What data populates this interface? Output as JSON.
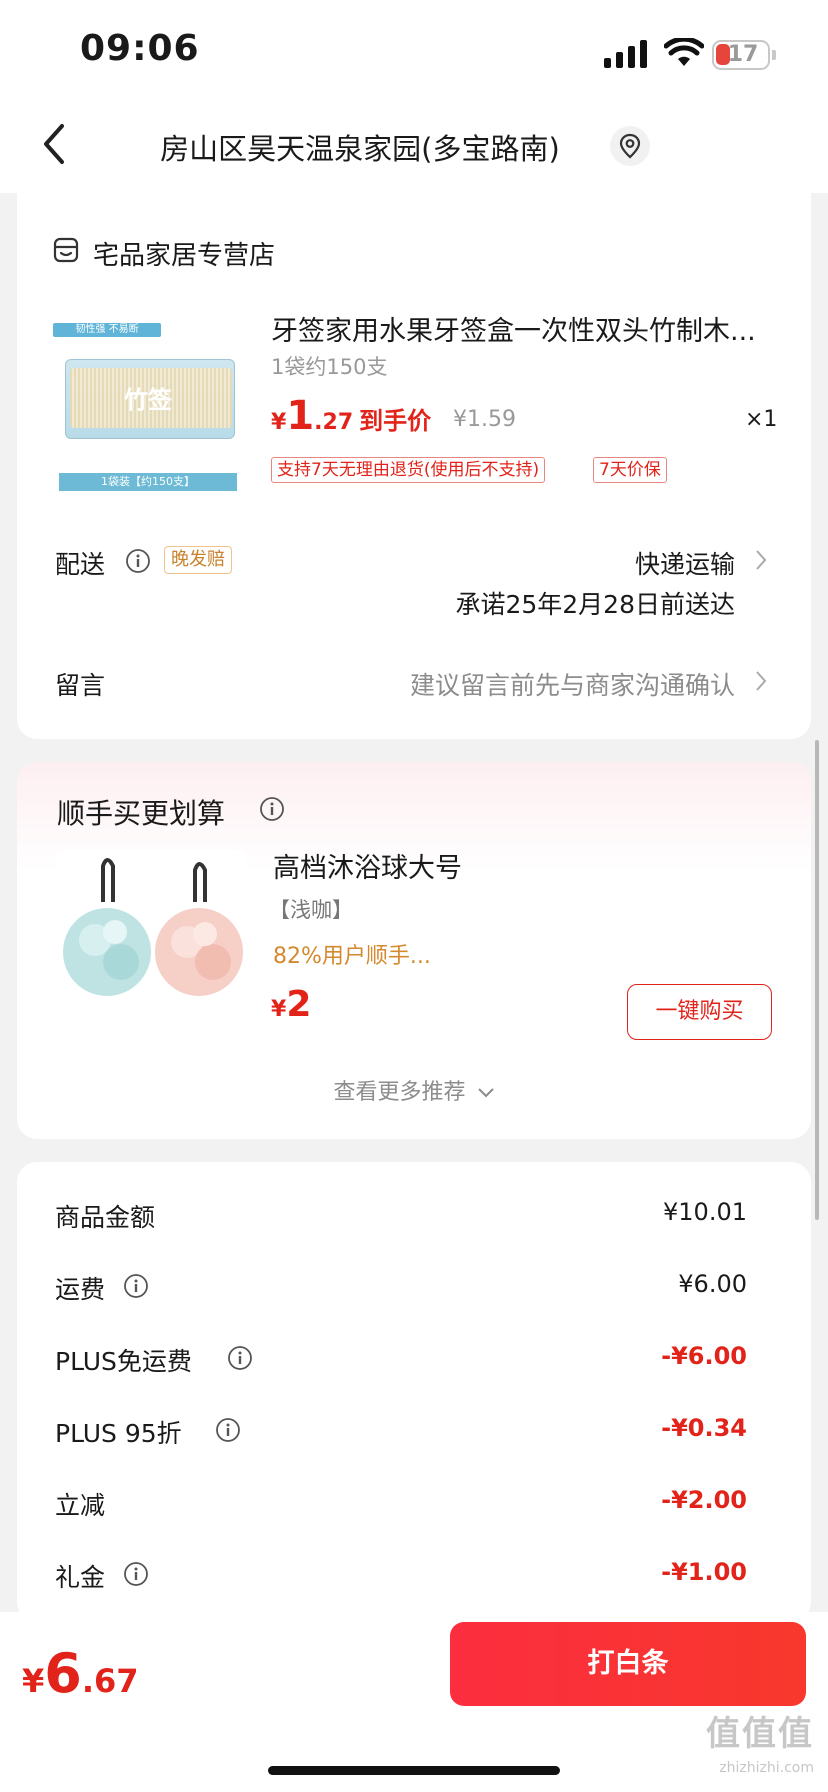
{
  "status_bar": {
    "time": "09:06",
    "battery": "17"
  },
  "header": {
    "address": "房山区昊天温泉家园(多宝路南)"
  },
  "store": {
    "name": "宅品家居专营店"
  },
  "product": {
    "image_badge": "韧性强 不易断",
    "image_caption": "1袋装【约150支】",
    "image_brand": "竹签",
    "title": "牙签家用水果牙签盒一次性双头竹制木...",
    "spec": "1袋约150支",
    "price_currency": "¥",
    "price_int": "1",
    "price_dec": ".27",
    "price_label": "到手价",
    "original_price": "¥1.59",
    "quantity": "×1",
    "tags": [
      "支持7天无理由退货(使用后不支持)",
      "7天价保"
    ]
  },
  "delivery": {
    "label": "配送",
    "tag": "晚发赔",
    "method": "快递运输",
    "promise": "承诺25年2月28日前送达"
  },
  "message": {
    "label": "留言",
    "placeholder": "建议留言前先与商家沟通确认"
  },
  "recommend": {
    "title": "顺手买更划算",
    "item_title": "高档沐浴球大号",
    "item_spec": "【浅咖】",
    "item_pct": "82%用户顺手...",
    "price_currency": "¥",
    "price": "2",
    "buy_label": "一键购买",
    "more_label": "查看更多推荐"
  },
  "summary": [
    {
      "label": "商品金额",
      "value": "¥10.01",
      "info": false,
      "type": "pos"
    },
    {
      "label": "运费",
      "value": "¥6.00",
      "info": true,
      "type": "pos"
    },
    {
      "label": "PLUS免运费",
      "value": "-¥6.00",
      "info": true,
      "type": "neg"
    },
    {
      "label": "PLUS 95折",
      "value": "-¥0.34",
      "info": true,
      "type": "neg"
    },
    {
      "label": "立减",
      "value": "-¥2.00",
      "info": false,
      "type": "neg"
    },
    {
      "label": "礼金",
      "value": "-¥1.00",
      "info": true,
      "type": "neg"
    }
  ],
  "bottom_bar": {
    "total_currency": "¥",
    "total_int": "6",
    "total_dec": ".67",
    "pay_label": "打白条"
  },
  "watermark": {
    "text": "值值值",
    "sub": "zhizhizhi.com"
  },
  "colors": {
    "accent_red": "#e2231a",
    "orange": "#d4892e",
    "background": "#f2f2f2"
  }
}
